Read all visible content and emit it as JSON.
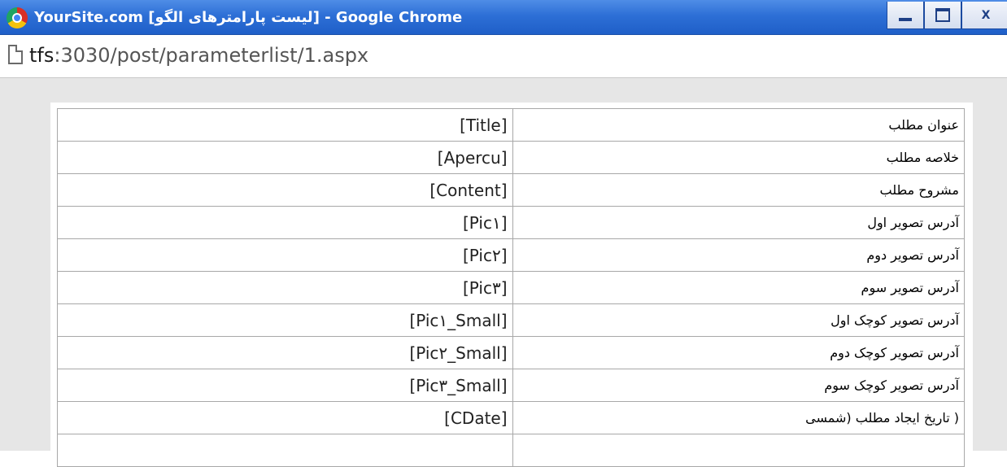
{
  "window": {
    "title": "YourSite.com [لیست پارامترهای الگو] - Google Chrome",
    "close_label": "X"
  },
  "address": {
    "host": "tfs",
    "path": ":3030/post/parameterlist/1.aspx"
  },
  "table": {
    "rows": [
      {
        "label": "عنوان مطلب",
        "value": "[Title]"
      },
      {
        "label": "خلاصه مطلب",
        "value": "[Apercu]"
      },
      {
        "label": "مشروح مطلب",
        "value": "[Content]"
      },
      {
        "label": "آدرس تصویر اول",
        "value": "[Pic۱]"
      },
      {
        "label": "آدرس تصویر دوم",
        "value": "[Pic۲]"
      },
      {
        "label": "آدرس تصویر سوم",
        "value": "[Pic۳]"
      },
      {
        "label": "آدرس تصویر کوچک اول",
        "value": "[Pic۱_Small]"
      },
      {
        "label": "آدرس تصویر کوچک دوم",
        "value": "[Pic۲_Small]"
      },
      {
        "label": "آدرس تصویر کوچک سوم",
        "value": "[Pic۳_Small]"
      },
      {
        "label": "( تاریخ ایجاد مطلب (شمسی",
        "value": "[CDate]"
      },
      {
        "label": "",
        "value": ""
      }
    ]
  }
}
